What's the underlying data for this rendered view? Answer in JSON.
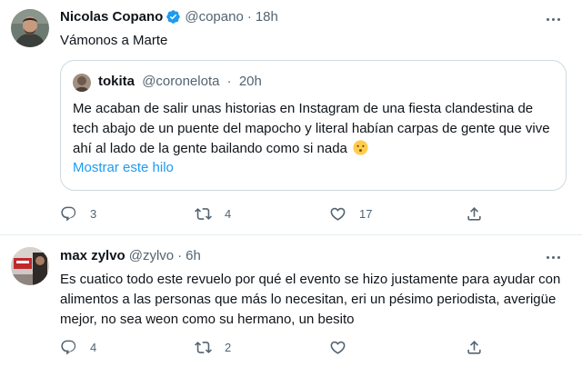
{
  "tweets": [
    {
      "name": "Nicolas Copano",
      "verified": true,
      "handle": "@copano",
      "separator": "·",
      "time": "18h",
      "text": "Vámonos a Marte",
      "quote": {
        "name": "tokita",
        "handle": "@coronelota",
        "separator": "·",
        "time": "20h",
        "text": "Me acaban de salir unas historias en Instagram de una fiesta clandestina de tech abajo de un puente del mapocho y literal habían carpas de gente que vive ahí al lado de la gente bailando como si nada",
        "link": "Mostrar este hilo"
      },
      "replies": "3",
      "retweets": "4",
      "likes": "17"
    },
    {
      "name": "max zylvo",
      "handle": "@zylvo",
      "separator": "·",
      "time": "6h",
      "text": "Es cuatico todo este revuelo por qué el evento se hizo justamente para ayudar con alimentos a las personas que más lo necesitan,  eri un pésimo periodista, averigüe mejor, no sea weon como su hermano, un besito",
      "replies": "4",
      "retweets": "2",
      "likes": ""
    }
  ],
  "colors": {
    "text": "#0f1419",
    "secondary": "#536471",
    "link": "#1d9bf0",
    "border": "#cfd9de"
  },
  "icons": {
    "reply": "reply-icon",
    "retweet": "retweet-icon",
    "like": "heart-icon",
    "share": "share-icon",
    "verified": "verified-badge-icon",
    "more": "more-icon",
    "emoji": "hushed-face-emoji"
  }
}
